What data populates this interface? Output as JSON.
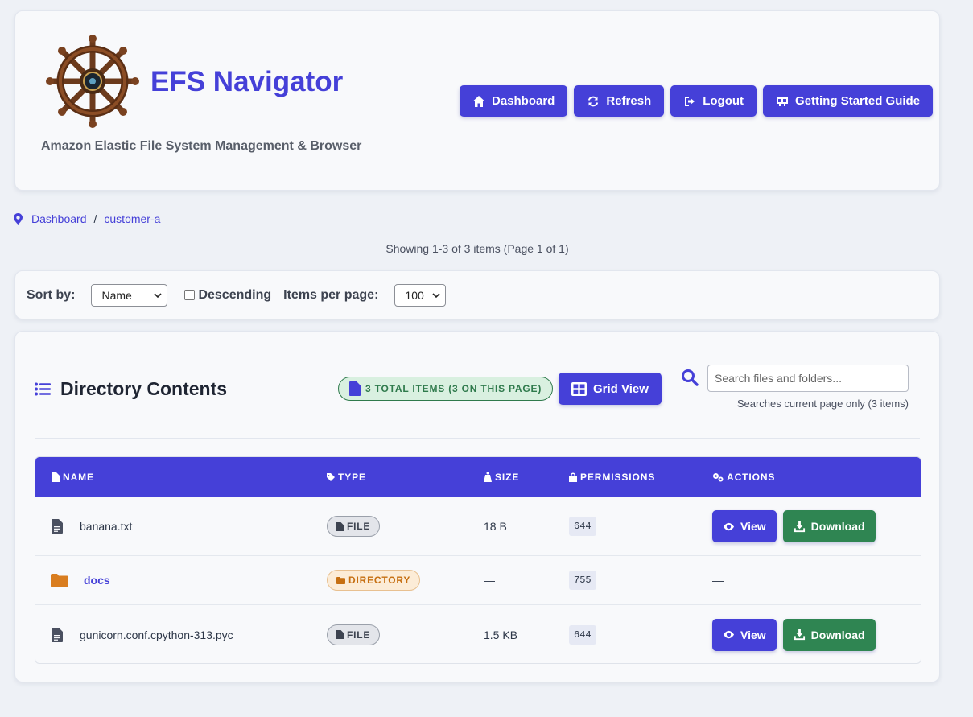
{
  "header": {
    "title": "EFS Navigator",
    "subtitle": "Amazon Elastic File System Management & Browser",
    "nav": [
      {
        "label": "Dashboard",
        "icon": "home-icon"
      },
      {
        "label": "Refresh",
        "icon": "refresh-icon"
      },
      {
        "label": "Logout",
        "icon": "logout-icon"
      },
      {
        "label": "Getting Started Guide",
        "icon": "guide-icon"
      }
    ]
  },
  "breadcrumb": {
    "icon": "location-pin-icon",
    "items": [
      "Dashboard",
      "customer-a"
    ],
    "separator": "/"
  },
  "pagination": {
    "showing": "Showing 1-3 of 3 items (Page 1 of 1)"
  },
  "sortbar": {
    "sort_label": "Sort by:",
    "sort_value": "Name",
    "descending_label": "Descending",
    "descending_checked": false,
    "per_page_label": "Items per page:",
    "per_page_value": "100"
  },
  "directory": {
    "heading": "Directory Contents",
    "total_badge": "3 TOTAL ITEMS (3 ON THIS PAGE)",
    "grid_view_label": "Grid View",
    "search_placeholder": "Search files and folders...",
    "search_hint": "Searches current page only (3 items)",
    "columns": [
      "NAME",
      "TYPE",
      "SIZE",
      "PERMISSIONS",
      "ACTIONS"
    ],
    "rows": [
      {
        "name": "banana.txt",
        "type": "FILE",
        "size": "18 B",
        "permissions": "644",
        "view": "View",
        "download": "Download"
      },
      {
        "name": "docs",
        "type": "DIRECTORY",
        "size": "—",
        "permissions": "755",
        "actions": "—"
      },
      {
        "name": "gunicorn.conf.cpython-313.pyc",
        "type": "FILE",
        "size": "1.5 KB",
        "permissions": "644",
        "view": "View",
        "download": "Download"
      }
    ]
  },
  "colors": {
    "accent": "#4540d8",
    "success": "#2f8552",
    "directory": "#c66f12",
    "background": "#eef1f6"
  }
}
